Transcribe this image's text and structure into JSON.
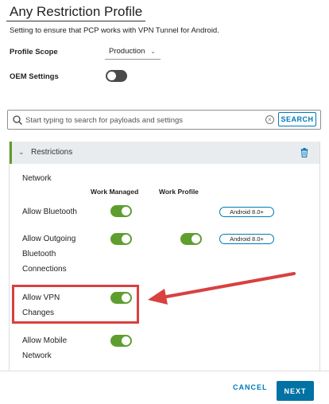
{
  "page": {
    "title": "Any Restriction Profile",
    "description": "Setting to ensure that PCP works with VPN Tunnel for Android."
  },
  "profile_scope": {
    "label": "Profile Scope",
    "value": "Production"
  },
  "oem_settings": {
    "label": "OEM Settings",
    "enabled": false
  },
  "search": {
    "placeholder": "Start typing to search for payloads and settings",
    "button_label": "SEARCH"
  },
  "restrictions": {
    "header_label": "Restrictions",
    "section_label": "Network",
    "col_work_managed": "Work Managed",
    "col_work_profile": "Work Profile",
    "rows": [
      {
        "label": "Allow Bluetooth",
        "work_managed": true,
        "badge": "Android 8.0+"
      },
      {
        "label_lines": [
          "Allow Outgoing",
          "Bluetooth",
          "Connections"
        ],
        "work_managed": true,
        "work_profile": true,
        "badge": "Android 8.0+"
      },
      {
        "label_lines": [
          "Allow VPN",
          "Changes"
        ],
        "work_managed": true
      },
      {
        "label_lines": [
          "Allow Mobile",
          "Network"
        ],
        "work_managed": true
      }
    ]
  },
  "colors": {
    "accent_green": "#5e9e2f",
    "primary_blue": "#0072a3",
    "highlight_red": "#d94040"
  },
  "footer": {
    "cancel_label": "CANCEL",
    "next_label": "NEXT"
  }
}
